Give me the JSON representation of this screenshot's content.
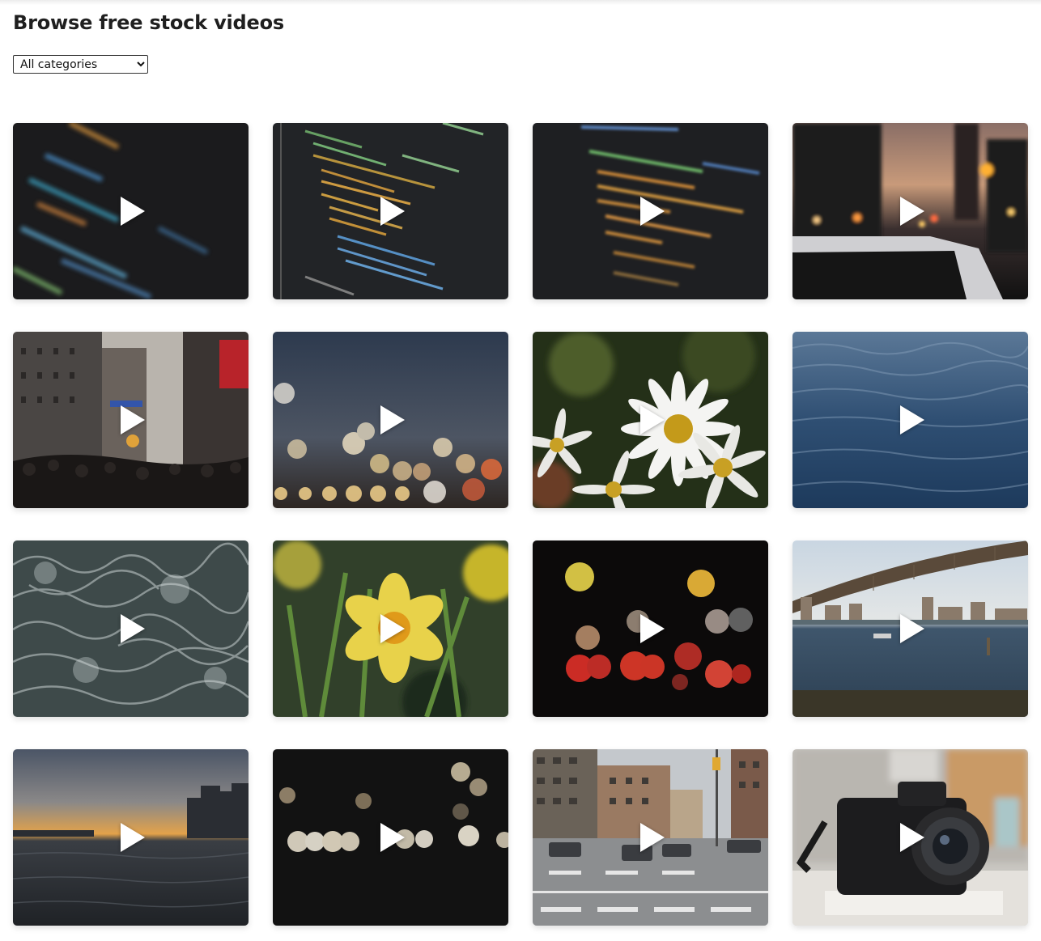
{
  "page_title": "Browse free stock videos",
  "category_filter": {
    "selected": "All categories",
    "options": [
      "All categories"
    ]
  },
  "videos": [
    {
      "thumbnail": "blurred code on dark screen",
      "icon": "play-icon"
    },
    {
      "thumbnail": "code editor close-up",
      "icon": "play-icon"
    },
    {
      "thumbnail": "code lines out of focus",
      "icon": "play-icon"
    },
    {
      "thumbnail": "city street at dusk from car",
      "icon": "play-icon"
    },
    {
      "thumbnail": "crowded city street",
      "icon": "play-icon"
    },
    {
      "thumbnail": "bokeh city lights",
      "icon": "play-icon"
    },
    {
      "thumbnail": "white daisies",
      "icon": "play-icon"
    },
    {
      "thumbnail": "blue water ripples",
      "icon": "play-icon"
    },
    {
      "thumbnail": "churning sea water",
      "icon": "play-icon"
    },
    {
      "thumbnail": "yellow daffodil",
      "icon": "play-icon"
    },
    {
      "thumbnail": "colorful bokeh on black",
      "icon": "play-icon"
    },
    {
      "thumbnail": "bridge over river",
      "icon": "play-icon"
    },
    {
      "thumbnail": "sunset over water with skyline",
      "icon": "play-icon"
    },
    {
      "thumbnail": "bokeh lights in darkness",
      "icon": "play-icon"
    },
    {
      "thumbnail": "city intersection traffic",
      "icon": "play-icon"
    },
    {
      "thumbnail": "camera on desk",
      "icon": "play-icon"
    }
  ]
}
